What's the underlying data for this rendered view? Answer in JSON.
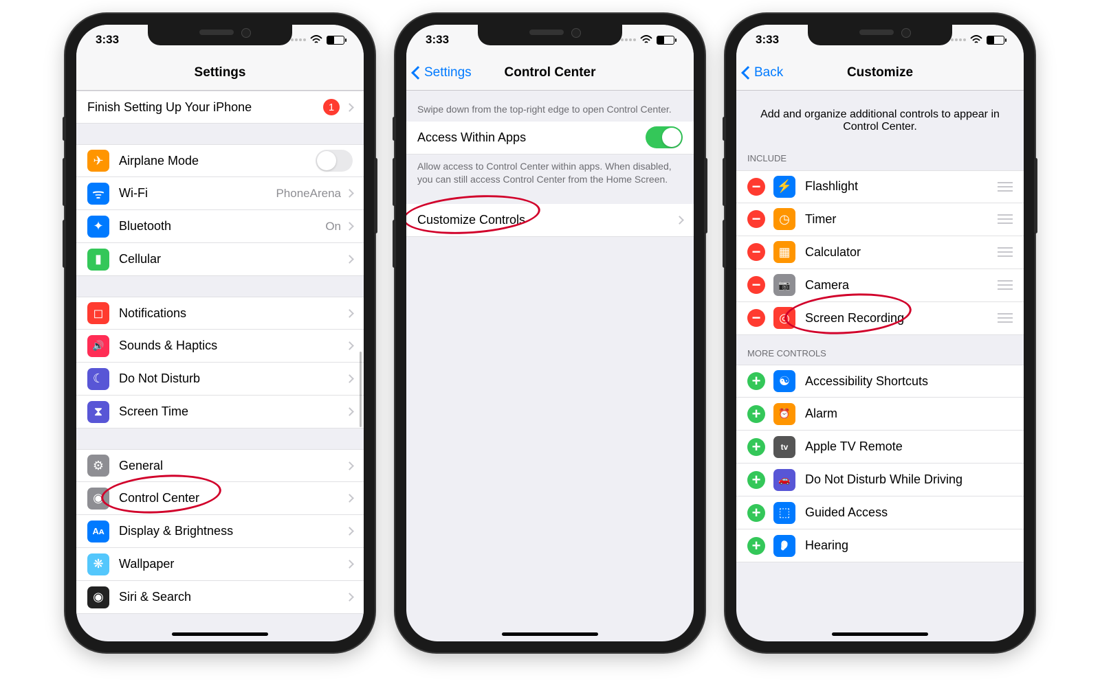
{
  "status": {
    "time": "3:33"
  },
  "phone1": {
    "title": "Settings",
    "setup": {
      "label": "Finish Setting Up Your iPhone",
      "badge": "1"
    },
    "group1": [
      {
        "icon": "plane",
        "color": "#ff9500",
        "label": "Airplane Mode",
        "type": "toggle",
        "on": false
      },
      {
        "icon": "wifi",
        "color": "#007aff",
        "label": "Wi-Fi",
        "detail": "PhoneArena"
      },
      {
        "icon": "bt",
        "color": "#007aff",
        "label": "Bluetooth",
        "detail": "On"
      },
      {
        "icon": "cell",
        "color": "#34c759",
        "label": "Cellular"
      }
    ],
    "group2": [
      {
        "icon": "notif",
        "color": "#ff3b30",
        "label": "Notifications"
      },
      {
        "icon": "sound",
        "color": "#ff2d55",
        "label": "Sounds & Haptics"
      },
      {
        "icon": "moon",
        "color": "#5856d6",
        "label": "Do Not Disturb"
      },
      {
        "icon": "hour",
        "color": "#5856d6",
        "label": "Screen Time"
      }
    ],
    "group3": [
      {
        "icon": "gear",
        "color": "#8e8e93",
        "label": "General"
      },
      {
        "icon": "cc",
        "color": "#8e8e93",
        "label": "Control Center",
        "circled": true
      },
      {
        "icon": "disp",
        "color": "#007aff",
        "label": "Display & Brightness"
      },
      {
        "icon": "wall",
        "color": "#54c7fc",
        "label": "Wallpaper"
      },
      {
        "icon": "siri",
        "color": "#222",
        "label": "Siri & Search"
      }
    ]
  },
  "phone2": {
    "back": "Settings",
    "title": "Control Center",
    "hint1": "Swipe down from the top-right edge to open Control Center.",
    "access": {
      "label": "Access Within Apps",
      "on": true
    },
    "hint2": "Allow access to Control Center within apps. When disabled, you can still access Control Center from the Home Screen.",
    "customize": {
      "label": "Customize Controls",
      "circled": true
    }
  },
  "phone3": {
    "back": "Back",
    "title": "Customize",
    "intro": "Add and organize additional controls to appear in Control Center.",
    "include_header": "Include",
    "include": [
      {
        "icon": "flash",
        "color": "#007aff",
        "label": "Flashlight"
      },
      {
        "icon": "timer",
        "color": "#ff9500",
        "label": "Timer"
      },
      {
        "icon": "calc",
        "color": "#ff9500",
        "label": "Calculator"
      },
      {
        "icon": "cam",
        "color": "#8e8e93",
        "label": "Camera"
      },
      {
        "icon": "rec",
        "color": "#ff3b30",
        "label": "Screen Recording",
        "circled": true
      }
    ],
    "more_header": "More Controls",
    "more": [
      {
        "icon": "access",
        "color": "#007aff",
        "label": "Accessibility Shortcuts"
      },
      {
        "icon": "alarm",
        "color": "#ff9500",
        "label": "Alarm"
      },
      {
        "icon": "tv",
        "color": "#555",
        "label": "Apple TV Remote"
      },
      {
        "icon": "car",
        "color": "#5856d6",
        "label": "Do Not Disturb While Driving"
      },
      {
        "icon": "guided",
        "color": "#007aff",
        "label": "Guided Access"
      },
      {
        "icon": "hear",
        "color": "#007aff",
        "label": "Hearing"
      }
    ]
  }
}
